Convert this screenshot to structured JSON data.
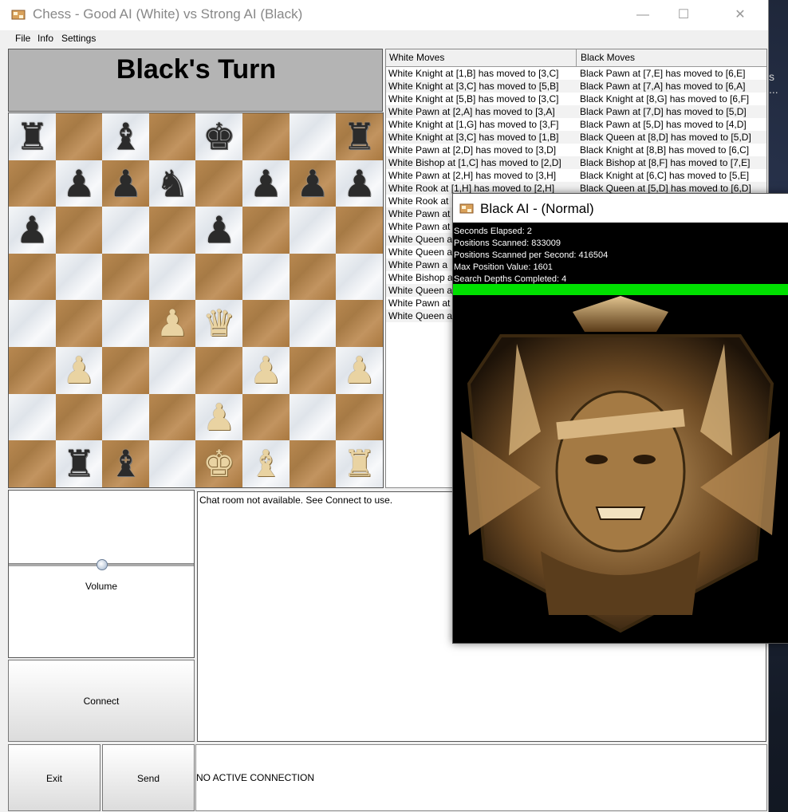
{
  "window": {
    "title": "Chess - Good AI (White) vs Strong AI (Black)",
    "minimize": "—",
    "maximize": "☐",
    "close": "✕"
  },
  "menu": {
    "file": "File",
    "info": "Info",
    "settings": "Settings"
  },
  "status": {
    "turn": "Black's Turn"
  },
  "board": {
    "rows": [
      [
        "bR",
        "",
        "bB",
        "",
        "bK",
        "",
        "",
        "bR"
      ],
      [
        "",
        "bP",
        "bP",
        "bN",
        "",
        "bP",
        "bP",
        "bP"
      ],
      [
        "bP",
        "",
        "",
        "",
        "bP",
        "",
        "",
        ""
      ],
      [
        "",
        "",
        "",
        "",
        "",
        "",
        "",
        ""
      ],
      [
        "",
        "",
        "",
        "wP",
        "wQ",
        "",
        "",
        ""
      ],
      [
        "",
        "wP",
        "",
        "",
        "",
        "wP",
        "",
        "wP"
      ],
      [
        "",
        "",
        "",
        "",
        "wP",
        "",
        "",
        ""
      ],
      [
        "",
        "bR",
        "bB",
        "",
        "wK",
        "wB",
        "",
        "wR"
      ]
    ]
  },
  "moves": {
    "white_header": "White Moves",
    "black_header": "Black Moves",
    "rows": [
      [
        "White Knight at [1,B] has moved to [3,C]",
        "Black Pawn at [7,E] has moved to [6,E]"
      ],
      [
        "White Knight at [3,C] has moved to [5,B]",
        "Black Pawn at [7,A] has moved to [6,A]"
      ],
      [
        "White Knight at [5,B] has moved to [3,C]",
        "Black Knight at [8,G] has moved to [6,F]"
      ],
      [
        "White Pawn at [2,A] has moved to [3,A]",
        "Black Pawn at [7,D] has moved to [5,D]"
      ],
      [
        "White Knight at [1,G] has moved to [3,F]",
        "Black Pawn at [5,D] has moved to [4,D]"
      ],
      [
        "White Knight at [3,C] has moved to [1,B]",
        "Black Queen at [8,D] has moved to [5,D]"
      ],
      [
        "White Pawn at [2,D] has moved to [3,D]",
        "Black Knight at [8,B] has moved to [6,C]"
      ],
      [
        "White Bishop at [1,C] has moved to [2,D]",
        "Black Bishop at [8,F] has moved to [7,E]"
      ],
      [
        "White Pawn at [2,H] has moved to [3,H]",
        "Black Knight at [6,C] has moved to [5,E]"
      ],
      [
        "White Rook at [1,H] has moved to [2,H]",
        "Black Queen at [5,D] has moved to [6,D]"
      ],
      [
        "White Rook at",
        ""
      ],
      [
        "White Pawn at",
        ""
      ],
      [
        "White Pawn at",
        ""
      ],
      [
        "White Queen a",
        ""
      ],
      [
        "White Queen a",
        ""
      ],
      [
        "White Pawn a",
        ""
      ],
      [
        "White Bishop a",
        ""
      ],
      [
        "White Queen a",
        ""
      ],
      [
        "White Pawn at",
        ""
      ],
      [
        "White Queen a",
        ""
      ]
    ]
  },
  "volume": {
    "label": "Volume",
    "level": 0.5
  },
  "buttons": {
    "connect": "Connect",
    "exit": "Exit",
    "send": "Send"
  },
  "chat": {
    "message": "Chat room not available. See Connect to use."
  },
  "connection": {
    "status": "NO ACTIVE CONNECTION"
  },
  "ai": {
    "title": "Black AI - (Normal)",
    "stats": [
      "Seconds Elapsed: 2",
      "Positions Scanned: 833009",
      "Positions Scanned per Second: 416504",
      "Max Position Value: 1601",
      "Search Depths Completed: 4"
    ],
    "progress_color": "#00e000"
  },
  "desktop": {
    "side_text_1": "s",
    "side_text_2": "..."
  }
}
